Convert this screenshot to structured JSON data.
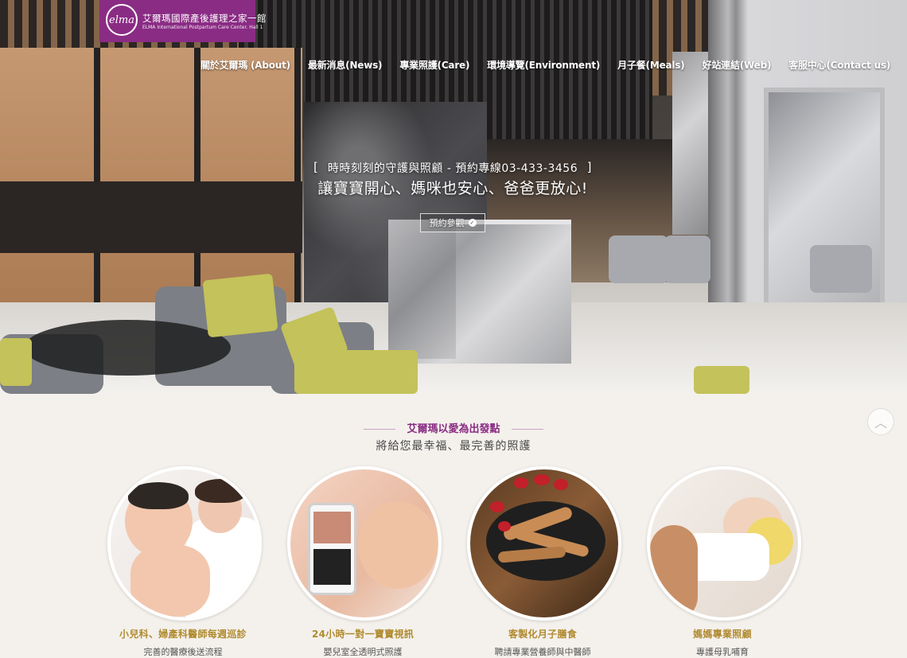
{
  "brand": {
    "logo_mark": "elma",
    "name_zh": "艾爾瑪國際產後護理之家一館",
    "name_en": "ELMA International Postpartum Care Center. Hall 1",
    "color": "#8a2c84"
  },
  "nav": {
    "items": [
      {
        "label": "關於艾爾瑪 (About)"
      },
      {
        "label": "最新消息(News)"
      },
      {
        "label": "專業照護(Care)"
      },
      {
        "label": "環境導覽(Environment)"
      },
      {
        "label": "月子餐(Meals)"
      },
      {
        "label": "好站連結(Web)"
      },
      {
        "label": "客服中心(Contact us)"
      }
    ]
  },
  "hero": {
    "bracket_left": "[",
    "bracket_right": "]",
    "line1": "時時刻刻的守護與照顧 - 預約專線03-433-3456",
    "line2": "讓寶寶開心、媽咪也安心、爸爸更放心!",
    "button_label": "預約參觀",
    "button_icon": "check-circle-icon"
  },
  "intro": {
    "title": "艾爾瑪以愛為出發點",
    "subtitle": "將給您最幸福、最完善的照護",
    "title_color": "#8a2c84"
  },
  "back_to_top": {
    "icon": "chevron-up-icon",
    "glyph": "︿"
  },
  "features": [
    {
      "title": "小兒科、婦產科醫師每週巡診",
      "desc": "完善的醫療後送流程",
      "image": "baby-with-doctor"
    },
    {
      "title": "24小時一對一寶寶視訊",
      "desc": "嬰兒室全透明式照護",
      "image": "baby-video-phone"
    },
    {
      "title": "客製化月子膳食",
      "desc": "聘請專業營養師與中醫師",
      "image": "herbal-meal"
    },
    {
      "title": "媽媽專業照顧",
      "desc": "專護母乳哺育",
      "image": "sleeping-baby"
    }
  ],
  "colors": {
    "feature_title": "#b08a2f",
    "background": "#f4f1ec"
  }
}
